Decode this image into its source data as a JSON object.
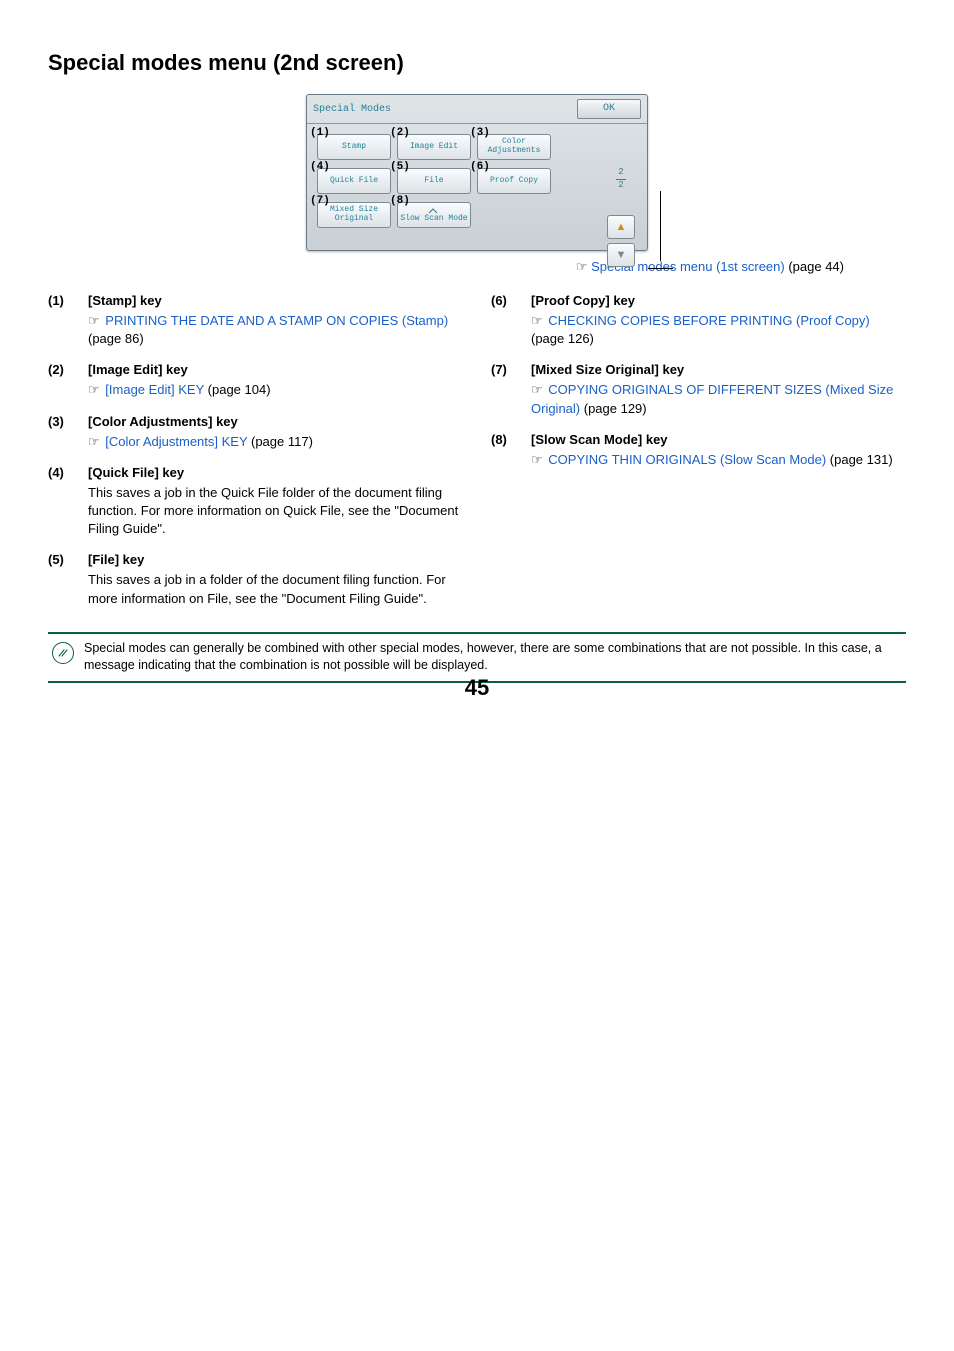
{
  "section_title": "Special modes menu (2nd screen)",
  "panel": {
    "title": "Special Modes",
    "ok": "OK",
    "buttons": [
      {
        "n": "(1)",
        "label": "Stamp"
      },
      {
        "n": "(2)",
        "label": "Image Edit"
      },
      {
        "n": "(3)",
        "label": "Color Adjustments",
        "two": true
      },
      {
        "n": "(4)",
        "label": "Quick File"
      },
      {
        "n": "(5)",
        "label": "File"
      },
      {
        "n": "(6)",
        "label": "Proof Copy"
      },
      {
        "n": "(7)",
        "label": "Mixed Size Original",
        "two": true
      },
      {
        "n": "(8)",
        "label": "Slow Scan Mode",
        "two": true
      }
    ],
    "page_indicator_top": "2",
    "page_indicator_bottom": "2"
  },
  "after_image_link": {
    "text": "Special modes menu (1st screen)",
    "suffix": " (page 44)"
  },
  "left_items": [
    {
      "num": "(1)",
      "title": "[Stamp] key",
      "link": "PRINTING THE DATE AND A STAMP ON COPIES (Stamp)",
      "suffix": " (page 86)"
    },
    {
      "num": "(2)",
      "title": "[Image Edit] key",
      "link": "[Image Edit] KEY",
      "suffix": " (page 104)"
    },
    {
      "num": "(3)",
      "title": "[Color Adjustments] key",
      "link": "[Color Adjustments] KEY",
      "suffix": " (page 117)"
    },
    {
      "num": "(4)",
      "title": "[Quick File] key",
      "body": "This saves a job in the Quick File folder of the document filing function. For more information on Quick File, see the \"Document Filing Guide\"."
    },
    {
      "num": "(5)",
      "title": "[File] key",
      "body": "This saves a job in a folder of the document filing function. For more information on File, see the \"Document Filing Guide\"."
    }
  ],
  "right_items": [
    {
      "num": "(6)",
      "title": "[Proof Copy] key",
      "link": "CHECKING COPIES BEFORE PRINTING (Proof Copy)",
      "suffix": " (page 126)"
    },
    {
      "num": "(7)",
      "title": "[Mixed Size Original] key",
      "link": "COPYING ORIGINALS OF DIFFERENT SIZES (Mixed Size Original)",
      "suffix": " (page 129)"
    },
    {
      "num": "(8)",
      "title": "[Slow Scan Mode] key",
      "link": "COPYING THIN ORIGINALS (Slow Scan Mode)",
      "suffix": " (page 131)"
    }
  ],
  "note": "Special modes can generally be combined with other special modes, however, there are some combinations that are not possible. In this case, a message indicating that the combination is not possible will be displayed.",
  "page_number": "45",
  "pointer_glyph": "☞"
}
